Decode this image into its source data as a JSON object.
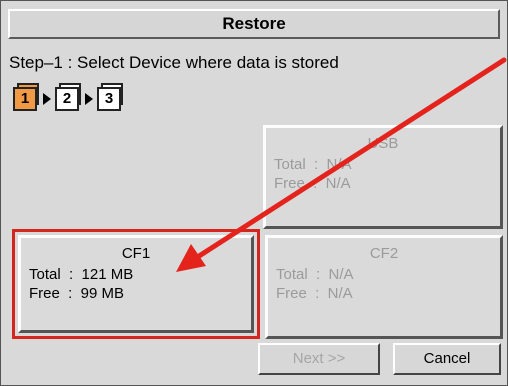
{
  "window": {
    "title": "Restore"
  },
  "step": {
    "instruction": "Step–1  :  Select Device where data is stored",
    "items": [
      {
        "label": "1",
        "active": true
      },
      {
        "label": "2",
        "active": false
      },
      {
        "label": "3",
        "active": false
      }
    ]
  },
  "devices": {
    "usb": {
      "name": "USB",
      "total": "Total  :  N/A",
      "free": "Free  :  N/A",
      "enabled": false
    },
    "cf1": {
      "name": "CF1",
      "total": "Total  :  121 MB",
      "free": "Free  :  99 MB",
      "enabled": true,
      "selected": true
    },
    "cf2": {
      "name": "CF2",
      "total": "Total  :  N/A",
      "free": "Free  :  N/A",
      "enabled": false
    }
  },
  "buttons": {
    "next": "Next  >>",
    "cancel": "Cancel"
  },
  "colors": {
    "panel_bg": "#d9d9d9",
    "active_step": "#f19a45",
    "highlight_red": "#d3261d",
    "disabled_text": "#9b9b9b"
  }
}
